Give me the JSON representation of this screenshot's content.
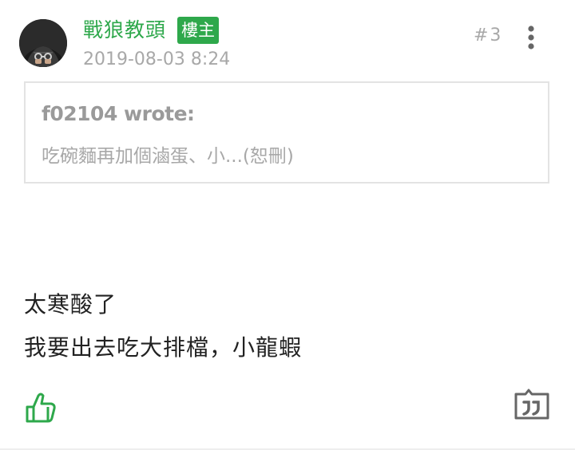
{
  "post": {
    "author": "戰狼教頭",
    "badge": "樓主",
    "time": "2019-08-03 8:24",
    "floor": "#3",
    "avatar_icon": "avatar-photo",
    "menu_icon": "more-vertical-icon"
  },
  "quote": {
    "author": "f02104 wrote:",
    "text": "吃碗麵再加個滷蛋、小...(恕刪)"
  },
  "content": {
    "lines": [
      "太寒酸了",
      "我要出去吃大排檔，小龍蝦"
    ]
  },
  "actions": {
    "like_icon": "thumbs-up-icon",
    "quote_icon": "quote-icon"
  },
  "colors": {
    "accent": "#2ea84b",
    "muted": "#a8a8a8",
    "text": "#222222",
    "border": "#e3e3e3"
  }
}
